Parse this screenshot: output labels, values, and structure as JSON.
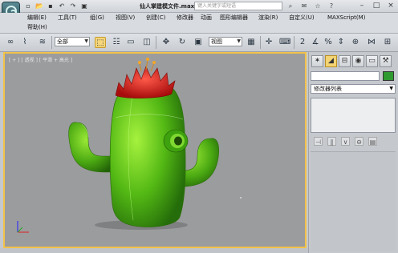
{
  "titlebar": {
    "title": "仙人掌建模文件.max",
    "search_placeholder": "键入关键字或短语"
  },
  "menu": {
    "row1": [
      "编辑(E)",
      "工具(T)",
      "组(G)",
      "视图(V)",
      "创建(C)",
      "修改器",
      "动画",
      "图形编辑器",
      "渲染(R)",
      "自定义(U)",
      "MAXScript(M)"
    ],
    "row2": [
      "帮助(H)"
    ]
  },
  "toolbar": {
    "filter_value": "全部",
    "refcoord_value": "视图"
  },
  "viewport": {
    "label": "[ + ] [ 透视 ] [ 平滑 + 高光 ]"
  },
  "command_panel": {
    "modifier_list": "修改器列表"
  },
  "colors": {
    "viewport_border": "#f2c24a",
    "object_color": "#2f9a2f",
    "cactus_green": "#5ec21a",
    "flower_red": "#d41f1f"
  }
}
